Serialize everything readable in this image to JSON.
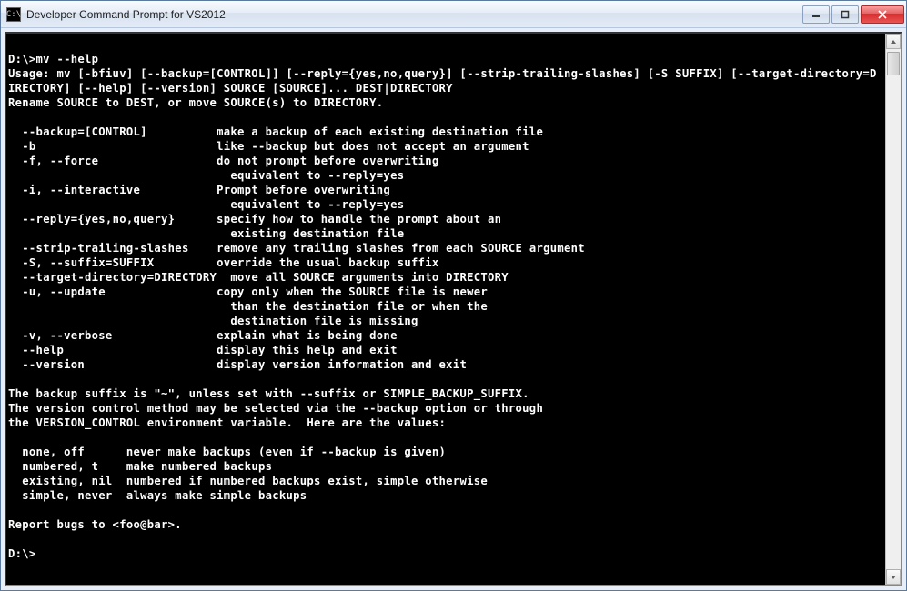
{
  "window": {
    "title": "Developer Command Prompt for VS2012",
    "icon_label": "C:\\"
  },
  "controls": {
    "minimize_name": "minimize-button",
    "maximize_name": "maximize-button",
    "close_name": "close-button"
  },
  "scrollbar": {
    "up_name": "scroll-up-button",
    "down_name": "scroll-down-button",
    "thumb_name": "scroll-thumb"
  },
  "console": {
    "text": "\nD:\\>mv --help\nUsage: mv [-bfiuv] [--backup=[CONTROL]] [--reply={yes,no,query}] [--strip-trailing-slashes] [-S SUFFIX] [--target-directory=DIRECTORY] [--help] [--version] SOURCE [SOURCE]... DEST|DIRECTORY\nRename SOURCE to DEST, or move SOURCE(s) to DIRECTORY.\n\n  --backup=[CONTROL]          make a backup of each existing destination file\n  -b                          like --backup but does not accept an argument\n  -f, --force                 do not prompt before overwriting\n                                equivalent to --reply=yes\n  -i, --interactive           Prompt before overwriting\n                                equivalent to --reply=yes\n  --reply={yes,no,query}      specify how to handle the prompt about an\n                                existing destination file\n  --strip-trailing-slashes    remove any trailing slashes from each SOURCE argument\n  -S, --suffix=SUFFIX         override the usual backup suffix\n  --target-directory=DIRECTORY  move all SOURCE arguments into DIRECTORY\n  -u, --update                copy only when the SOURCE file is newer\n                                than the destination file or when the\n                                destination file is missing\n  -v, --verbose               explain what is being done\n  --help                      display this help and exit\n  --version                   display version information and exit\n\nThe backup suffix is \"~\", unless set with --suffix or SIMPLE_BACKUP_SUFFIX.\nThe version control method may be selected via the --backup option or through\nthe VERSION_CONTROL environment variable.  Here are the values:\n\n  none, off      never make backups (even if --backup is given)\n  numbered, t    make numbered backups\n  existing, nil  numbered if numbered backups exist, simple otherwise\n  simple, never  always make simple backups\n\nReport bugs to <foo@bar>.\n\nD:\\>"
  }
}
